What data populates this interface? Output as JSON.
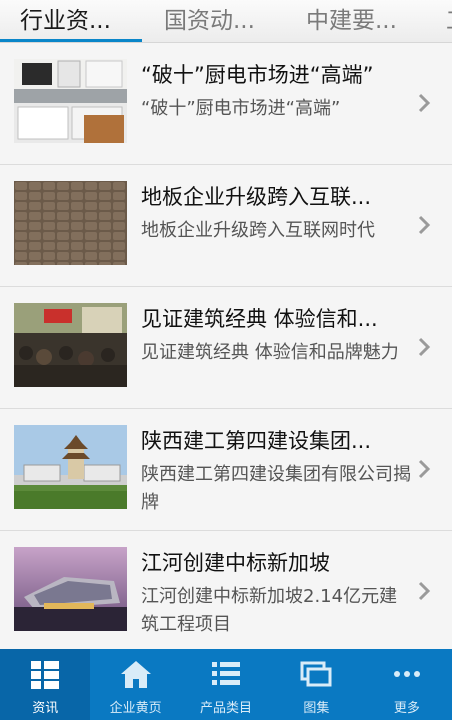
{
  "tabs": [
    {
      "label": "行业资..."
    },
    {
      "label": "国资动..."
    },
    {
      "label": "中建要..."
    },
    {
      "label": "工"
    }
  ],
  "active_tab": 0,
  "news": [
    {
      "title": "“破十”厨电市场进“高端”",
      "summary": "“破十”厨电市场进“高端”"
    },
    {
      "title": "地板企业升级跨入互联...",
      "summary": "地板企业升级跨入互联网时代"
    },
    {
      "title": "见证建筑经典 体验信和...",
      "summary": "见证建筑经典 体验信和品牌魅力"
    },
    {
      "title": "陕西建工第四建设集团...",
      "summary": "陕西建工第四建设集团有限公司揭牌"
    },
    {
      "title": "江河创建中标新加坡",
      "summary": "江河创建中标新加坡2.14亿元建筑工程项目"
    }
  ],
  "bottom_nav": [
    {
      "label": "资讯",
      "icon": "list-grid-icon"
    },
    {
      "label": "企业黄页",
      "icon": "home-icon"
    },
    {
      "label": "产品类目",
      "icon": "list-icon"
    },
    {
      "label": "图集",
      "icon": "gallery-icon"
    },
    {
      "label": "更多",
      "icon": "more-dots-icon"
    }
  ],
  "colors": {
    "accent": "#0a86c9",
    "nav_bg": "#0a79c2",
    "nav_active_bg": "#0866a8",
    "item_bg": "#f5f5f5"
  }
}
